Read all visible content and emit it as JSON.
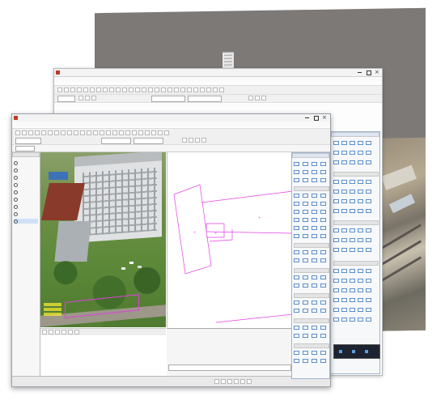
{
  "back_window": {
    "title": ""
  },
  "middle_window": {
    "title": "",
    "menu": [
      "",
      "",
      "",
      "",
      "",
      "",
      "",
      "",
      "",
      "",
      "",
      "",
      "",
      ""
    ],
    "combo_a": "",
    "combo_b": "",
    "combo_c": ""
  },
  "front_window": {
    "title": "",
    "menu": [
      "",
      "",
      "",
      "",
      "",
      "",
      "",
      "",
      "",
      "",
      "",
      "",
      ""
    ],
    "layer_panel": {
      "title": "",
      "rows": [
        "",
        "",
        "",
        "",
        "",
        "",
        "",
        "",
        "",
        "",
        "",
        "",
        ""
      ]
    },
    "drawing": {
      "title": ""
    },
    "command": {
      "lines": [
        "",
        "",
        "",
        ""
      ]
    },
    "status": {
      "coords": ""
    }
  },
  "palette": {
    "title": "",
    "sections": [
      "",
      "",
      "",
      "",
      "",
      ""
    ]
  },
  "right_palette": {
    "title": "",
    "sections": [
      "",
      "",
      ""
    ]
  },
  "colors": {
    "drawing_lines": "#e040e0",
    "title_bar": "#f3f3f3",
    "palette_border": "#5a8ec8",
    "photo_green": "#5e8a3a",
    "backdrop_gray": "#7c7976"
  },
  "icons": [
    "building-icon",
    "app-icon",
    "minimize-icon",
    "maximize-icon",
    "close-icon",
    "tool-icon",
    "layer-icon",
    "eye-icon"
  ]
}
